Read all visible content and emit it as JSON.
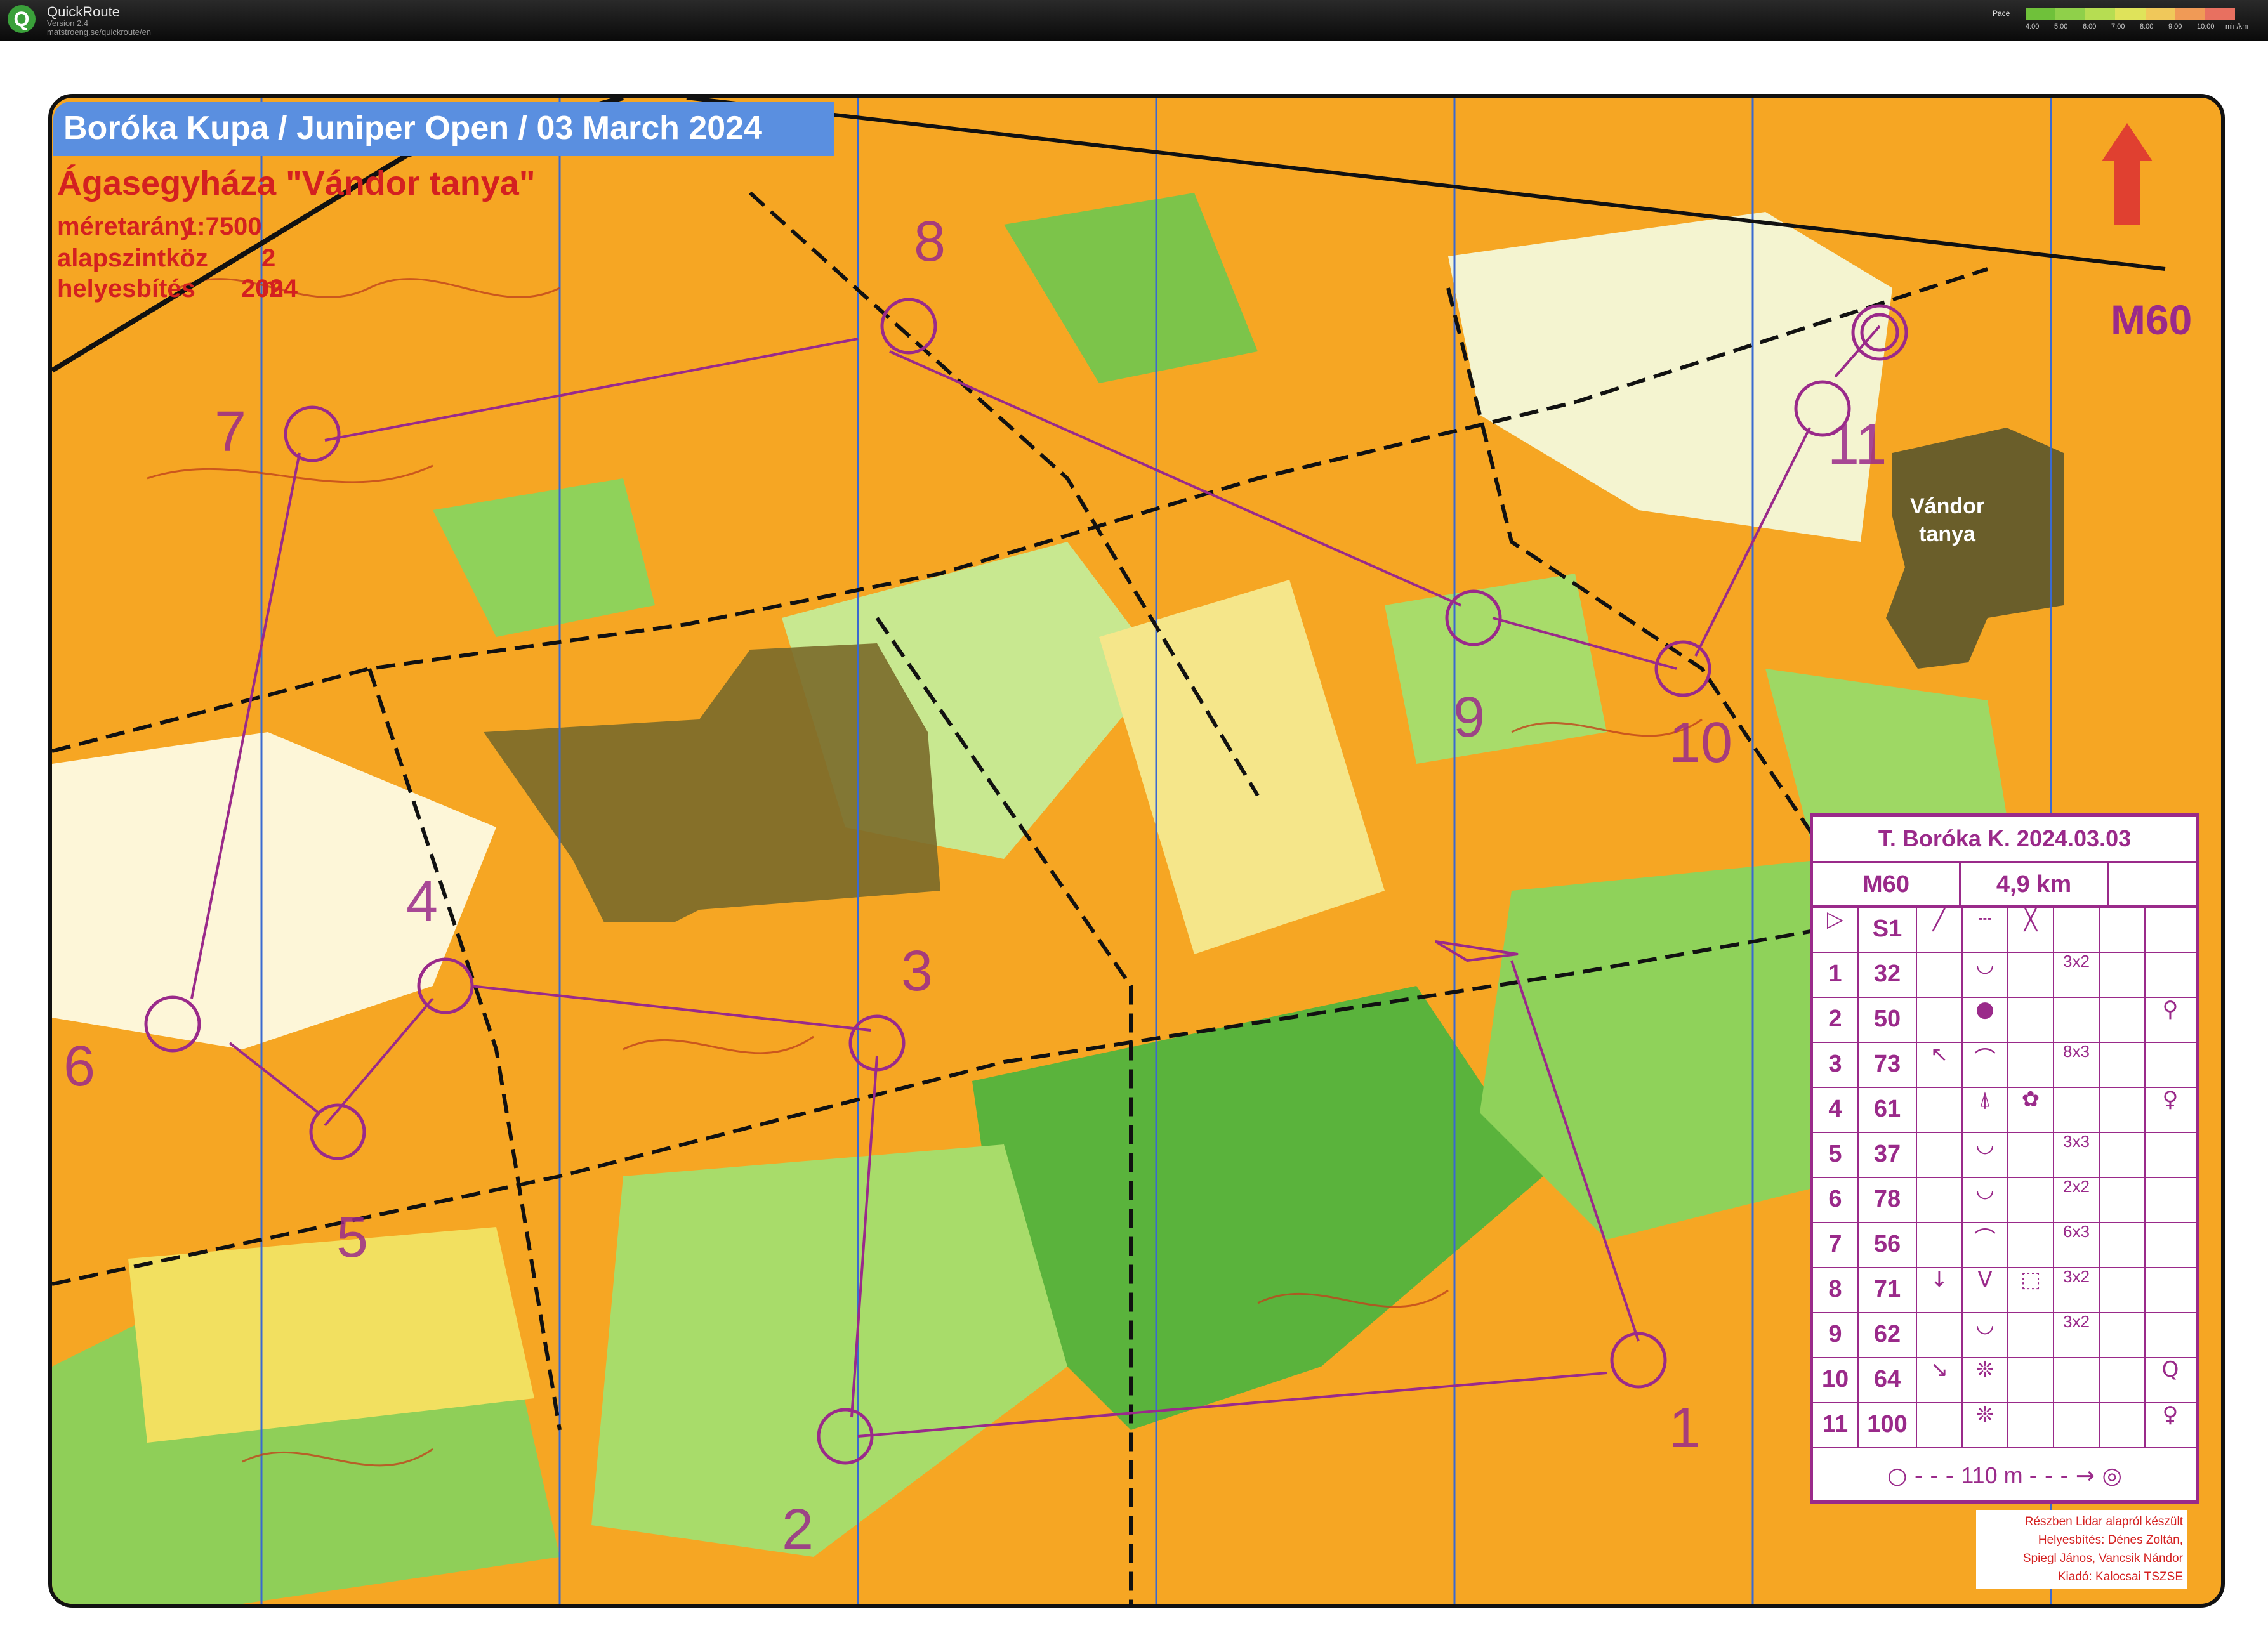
{
  "app": {
    "name": "QuickRoute",
    "version": "Version 2.4",
    "url": "matstroeng.se/quickroute/en",
    "pace_label": "Pace",
    "pace_ticks": [
      "4:00",
      "5:00",
      "6:00",
      "7:00",
      "8:00",
      "9:00",
      "10:00",
      "min/km"
    ]
  },
  "map": {
    "event_title": "Boróka Kupa / Juniper Open / 03 March 2024",
    "place": "Ágasegyháza \"Vándor tanya\"",
    "info": [
      {
        "label": "méretarány",
        "value": "1:7500"
      },
      {
        "label": "alapszintköz",
        "value": "2 m"
      },
      {
        "label": "helyesbítés",
        "value": "2024"
      }
    ],
    "category": "M60",
    "farm_label_1": "Vándor",
    "farm_label_2": "tanya",
    "control_numbers": [
      "1",
      "2",
      "3",
      "4",
      "5",
      "6",
      "7",
      "8",
      "9",
      "10",
      "11"
    ],
    "credits": [
      "Részben Lidar alapról készült",
      "Helyesbítés: Dénes Zoltán,",
      "Spiegl János, Vancsik Nándor",
      "Kiadó: Kalocsai TSZSE"
    ]
  },
  "description": {
    "title": "T. Boróka K. 2024.03.03",
    "class": "M60",
    "length": "4,9 km",
    "start_code": "S1",
    "rows": [
      {
        "n": "1",
        "code": "32",
        "c": "",
        "d": "◡",
        "e": "",
        "f": "3x2",
        "g": "",
        "h": ""
      },
      {
        "n": "2",
        "code": "50",
        "c": "",
        "d": "●",
        "e": "",
        "f": "",
        "g": "",
        "h": "⚲"
      },
      {
        "n": "3",
        "code": "73",
        "c": "↖",
        "d": "⌒",
        "e": "",
        "f": "8x3",
        "g": "",
        "h": ""
      },
      {
        "n": "4",
        "code": "61",
        "c": "",
        "d": "⍋",
        "e": "✿",
        "f": "",
        "g": "",
        "h": "♀"
      },
      {
        "n": "5",
        "code": "37",
        "c": "",
        "d": "◡",
        "e": "",
        "f": "3x3",
        "g": "",
        "h": ""
      },
      {
        "n": "6",
        "code": "78",
        "c": "",
        "d": "◡",
        "e": "",
        "f": "2x2",
        "g": "",
        "h": ""
      },
      {
        "n": "7",
        "code": "56",
        "c": "",
        "d": "⌒",
        "e": "",
        "f": "6x3",
        "g": "",
        "h": ""
      },
      {
        "n": "8",
        "code": "71",
        "c": "↓",
        "d": "V",
        "e": "⬚",
        "f": "3x2",
        "g": "",
        "h": ""
      },
      {
        "n": "9",
        "code": "62",
        "c": "",
        "d": "◡",
        "e": "",
        "f": "3x2",
        "g": "",
        "h": ""
      },
      {
        "n": "10",
        "code": "64",
        "c": "↘",
        "d": "❊",
        "e": "",
        "f": "",
        "g": "",
        "h": "Q"
      },
      {
        "n": "11",
        "code": "100",
        "c": "",
        "d": "❊",
        "e": "",
        "f": "",
        "g": "",
        "h": "♀"
      }
    ],
    "finish": "110 m"
  },
  "colors": {
    "course": "#9a2a8a",
    "open_land": "#f6a623",
    "forest": "#5ab33c",
    "contour": "#c0431b",
    "banner": "#5a8fe0",
    "text_red": "#d42020"
  }
}
